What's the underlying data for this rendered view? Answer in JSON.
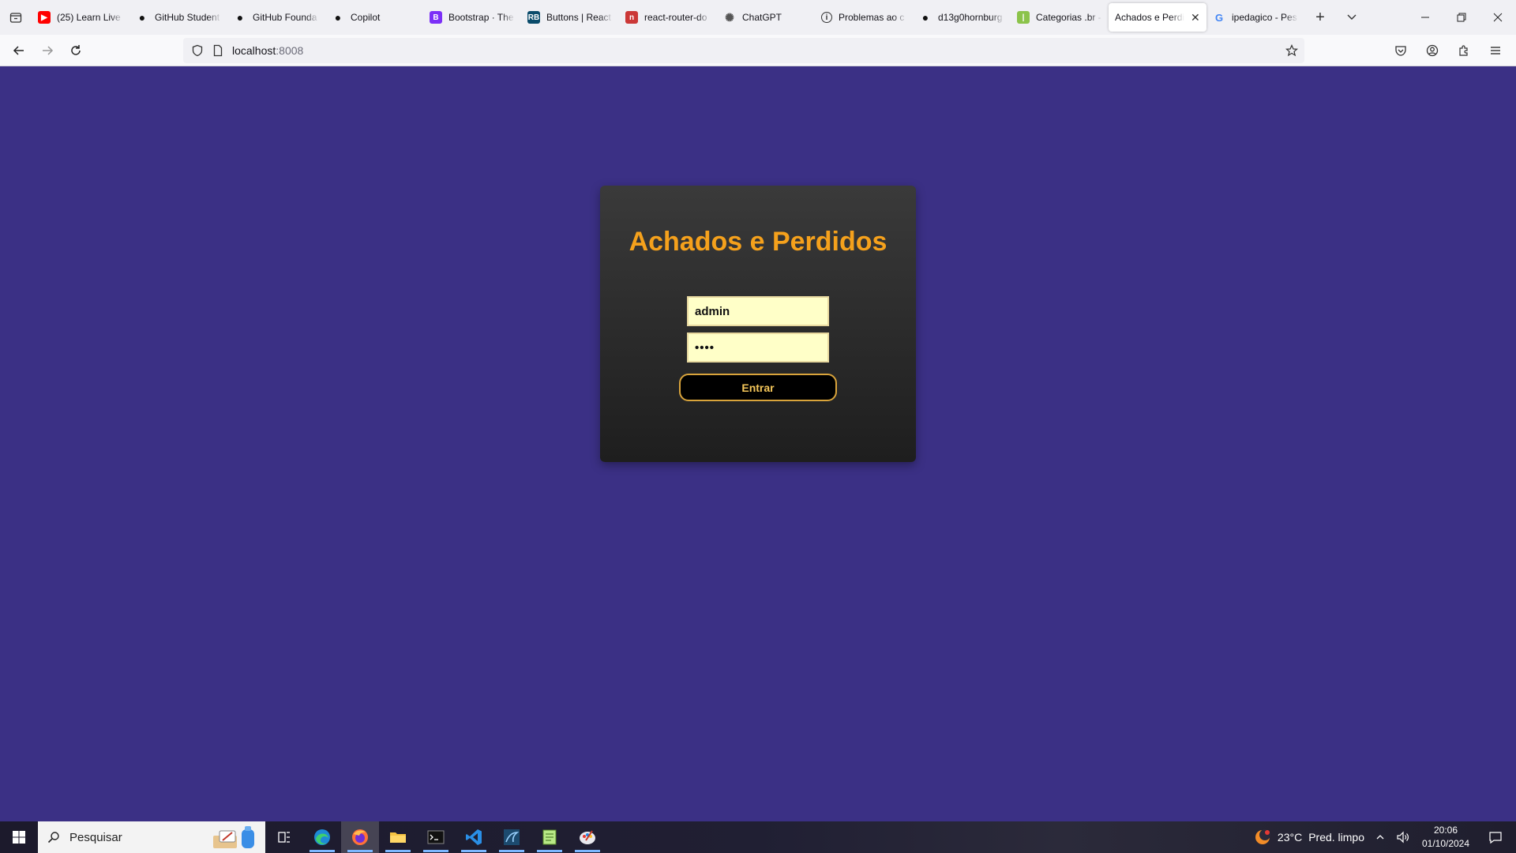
{
  "browser": {
    "tabs": [
      {
        "title": "(25) Learn Live",
        "favicon": "youtube-icon",
        "color": "#ff0000",
        "active": false
      },
      {
        "title": "GitHub Student",
        "favicon": "github-icon",
        "color": "#111111",
        "active": false
      },
      {
        "title": "GitHub Founda",
        "favicon": "github-icon",
        "color": "#111111",
        "active": false
      },
      {
        "title": "Copilot",
        "favicon": "github-icon",
        "color": "#111111",
        "active": false
      },
      {
        "title": "Bootstrap · The",
        "favicon": "bootstrap-icon",
        "color": "#7b2ff7",
        "active": false
      },
      {
        "title": "Buttons | React",
        "favicon": "react-bootstrap-icon",
        "color": "#0a4b6b",
        "active": false
      },
      {
        "title": "react-router-do",
        "favicon": "npm-icon",
        "color": "#cb3837",
        "active": false
      },
      {
        "title": "ChatGPT",
        "favicon": "chatgpt-icon",
        "color": "#555555",
        "active": false
      },
      {
        "title": "Problemas ao c",
        "favicon": "info-icon",
        "color": "#333333",
        "active": false
      },
      {
        "title": "d13g0hornburg",
        "favicon": "github-icon",
        "color": "#111111",
        "active": false
      },
      {
        "title": "Categorias .br -",
        "favicon": "categorias-icon",
        "color": "#8bc34a",
        "active": false
      },
      {
        "title": "Achados e Perdid",
        "favicon": "none",
        "color": "#ffffff",
        "active": true
      },
      {
        "title": "ipedagico - Pes",
        "favicon": "google-icon",
        "color": "#4285f4",
        "active": false
      }
    ],
    "url": {
      "host": "localhost",
      "port": ":8008"
    }
  },
  "page": {
    "title": "Achados e Perdidos",
    "username_value": "admin",
    "password_mask": "••••",
    "submit_label": "Entrar",
    "background_color": "#3b3085",
    "accent_color": "#f5a11c"
  },
  "taskbar": {
    "search_placeholder": "Pesquisar",
    "weather": {
      "temp": "23°C",
      "desc": "Pred. limpo"
    },
    "clock": {
      "time": "20:06",
      "date": "01/10/2024"
    }
  }
}
